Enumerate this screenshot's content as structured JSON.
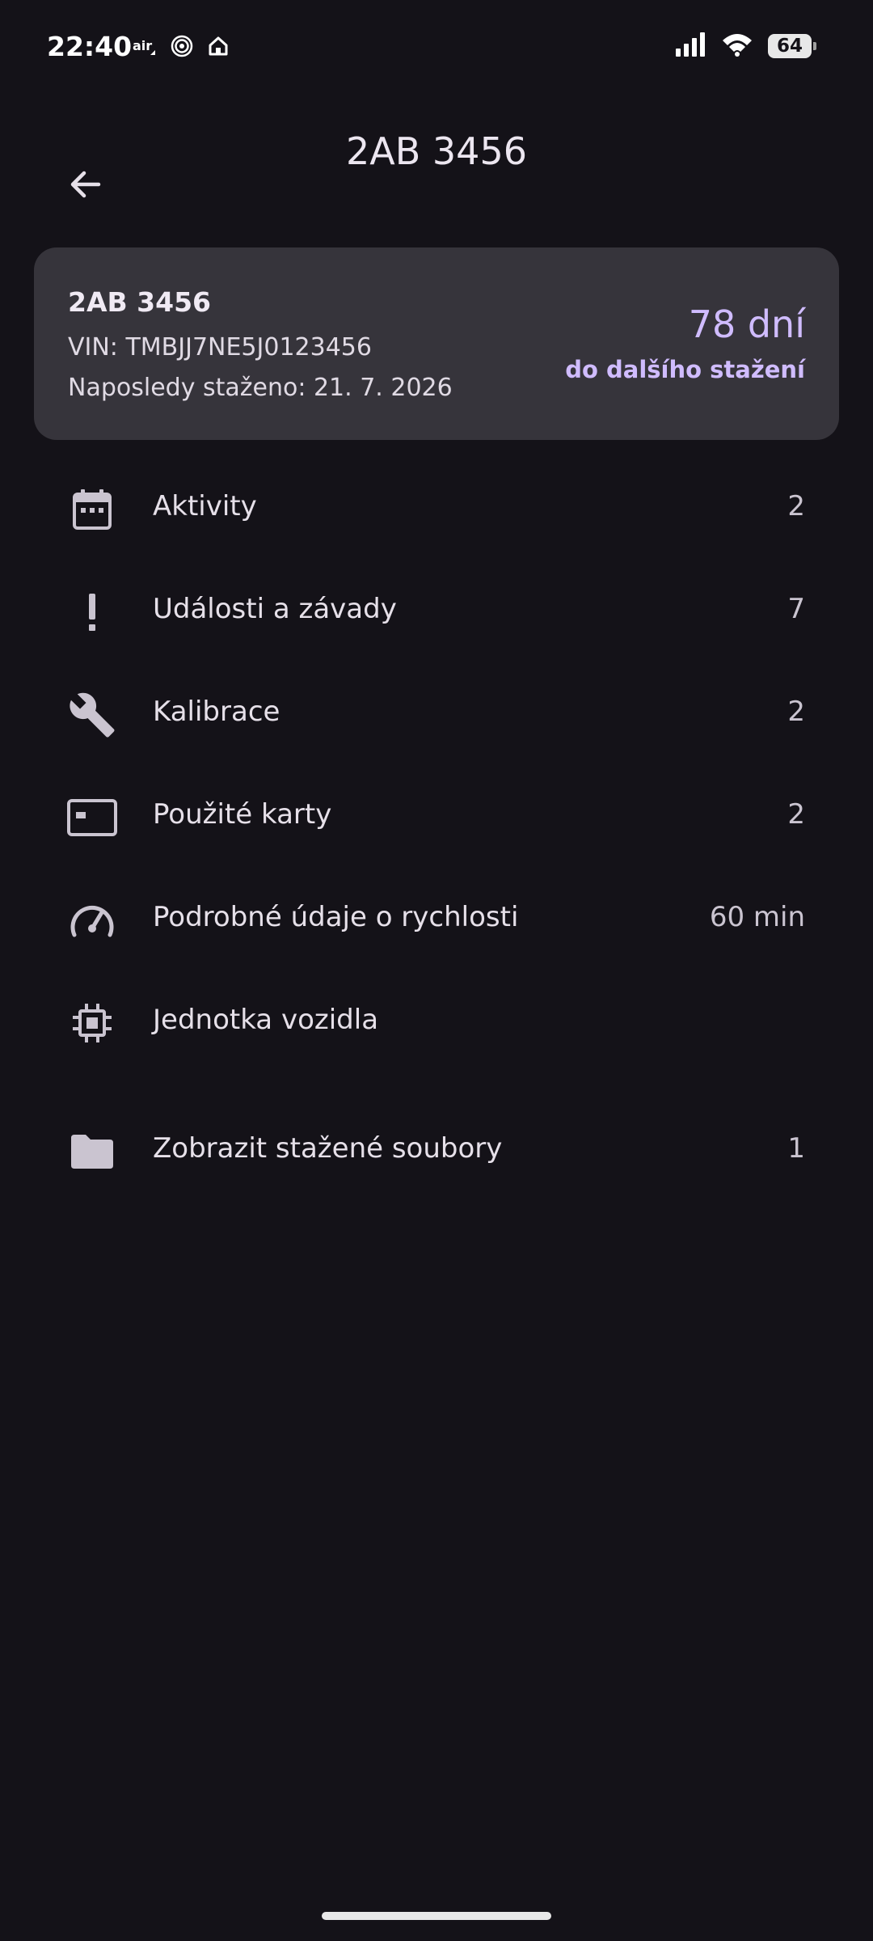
{
  "status_bar": {
    "time": "22:40",
    "left_icons": [
      "air-icon",
      "target-icon",
      "home-icon"
    ],
    "battery": "64"
  },
  "header": {
    "title": "2AB 3456"
  },
  "vehicle_card": {
    "plate": "2AB 3456",
    "vin": "VIN: TMBJJ7NE5J0123456",
    "last_download": "Naposledy staženo: 21. 7. 2026",
    "days_value": "78 dní",
    "days_caption": "do dalšího stažení"
  },
  "menu": {
    "items": [
      {
        "label": "Aktivity",
        "count": "2",
        "icon": "calendar-icon"
      },
      {
        "label": "Události a závady",
        "count": "7",
        "icon": "exclamation-icon"
      },
      {
        "label": "Kalibrace",
        "count": "2",
        "icon": "wrench-icon"
      },
      {
        "label": "Použité karty",
        "count": "2",
        "icon": "card-icon"
      },
      {
        "label": "Podrobné údaje o rychlosti",
        "count": "60 min",
        "icon": "speedometer-icon"
      },
      {
        "label": "Jednotka vozidla",
        "count": "",
        "icon": "chip-icon"
      },
      {
        "label": "Zobrazit stažené soubory",
        "count": "1",
        "icon": "folder-icon"
      }
    ]
  },
  "colors": {
    "background": "#141218",
    "card": "#36343b",
    "accent": "#d0bcff"
  }
}
